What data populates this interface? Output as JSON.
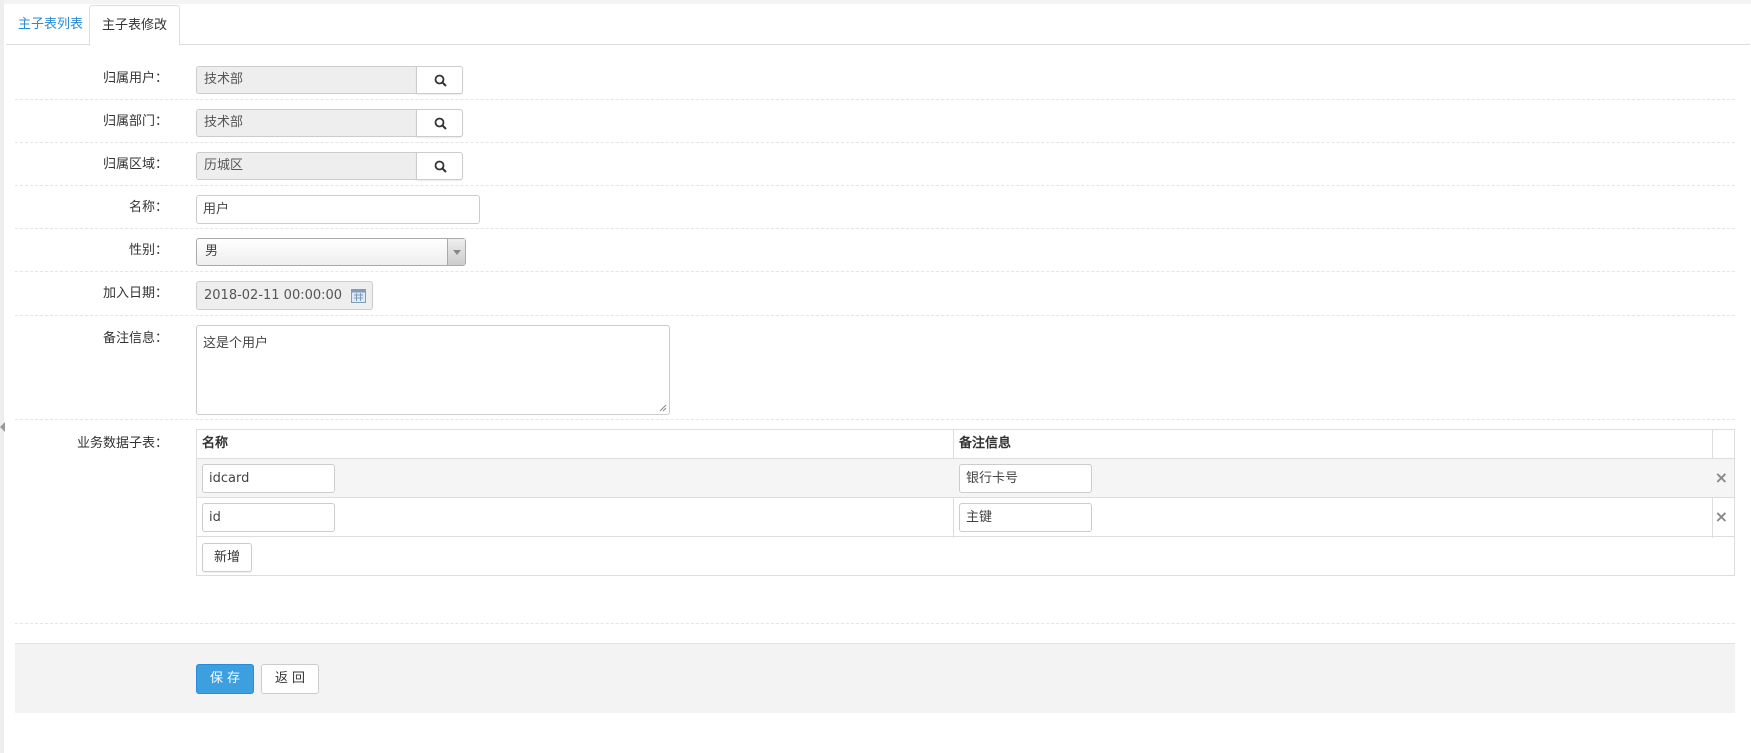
{
  "tabs": [
    {
      "label": "主子表列表",
      "active": false
    },
    {
      "label": "主子表修改",
      "active": true
    }
  ],
  "form": {
    "owner_user": {
      "label": "归属用户：",
      "value": "技术部"
    },
    "owner_dept": {
      "label": "归属部门：",
      "value": "技术部"
    },
    "owner_area": {
      "label": "归属区域：",
      "value": "历城区"
    },
    "name": {
      "label": "名称：",
      "value": "用户"
    },
    "gender": {
      "label": "性别：",
      "value": "男"
    },
    "join_date": {
      "label": "加入日期：",
      "value": "2018-02-11 00:00:00"
    },
    "remarks": {
      "label": "备注信息：",
      "value": "这是个用户"
    },
    "subtable": {
      "label": "业务数据子表：",
      "columns": [
        "名称",
        "备注信息"
      ],
      "rows": [
        {
          "name": "idcard",
          "remark": "银行卡号"
        },
        {
          "name": "id",
          "remark": "主键"
        }
      ],
      "add_label": "新增",
      "delete_symbol": "×"
    }
  },
  "actions": {
    "save_label": "保存",
    "back_label": "返回"
  },
  "colors": {
    "accent": "#3c9fe0",
    "link": "#2a8bd6",
    "readonly_bg": "#eeeeee"
  },
  "icons": [
    "search-icon",
    "calendar-icon",
    "chevron-down-icon",
    "delete-icon",
    "resize-grip-icon"
  ]
}
